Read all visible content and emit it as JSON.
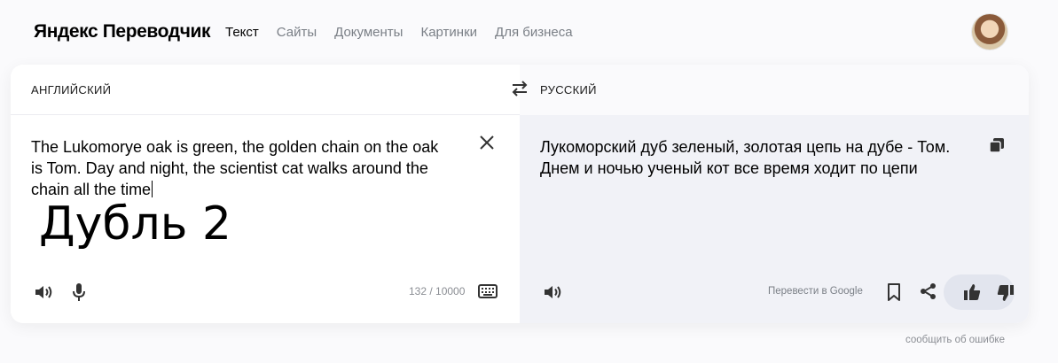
{
  "header": {
    "logo": "Яндекс Переводчик",
    "nav": [
      "Текст",
      "Сайты",
      "Документы",
      "Картинки",
      "Для бизнеса"
    ]
  },
  "source": {
    "language": "АНГЛИЙСКИЙ",
    "text": "The Lukomorye oak is green, the golden chain on the oak is Tom. Day and night, the scientist cat walks around the chain all the time",
    "overlay_text": "Дубль 2",
    "char_count": "132 / 10000"
  },
  "target": {
    "language": "РУССКИЙ",
    "text": "Лукоморский дуб зеленый, золотая цепь на дубе - Том. Днем и ночью ученый кот все время ходит по цепи",
    "translate_in_google": "Перевести в Google"
  },
  "footer": {
    "report_error": "сообщить об ошибке"
  },
  "icons": {
    "swap": "swap-arrows-icon",
    "clear": "close-icon",
    "speaker": "speaker-icon",
    "mic": "microphone-icon",
    "keyboard": "keyboard-icon",
    "copy": "copy-icon",
    "bookmark": "bookmark-icon",
    "share": "share-icon",
    "like": "thumbs-up-icon",
    "dislike": "thumbs-down-icon"
  }
}
